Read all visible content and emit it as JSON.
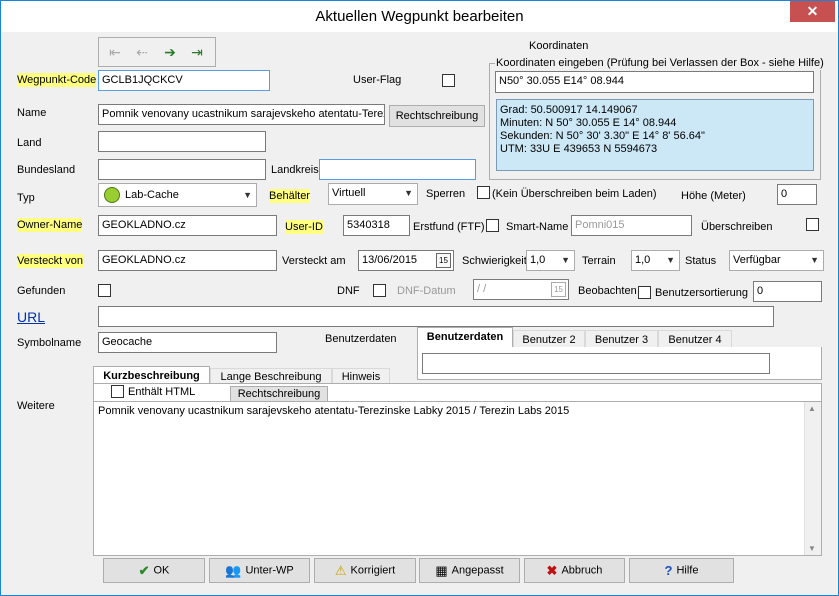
{
  "window": {
    "title": "Aktuellen Wegpunkt bearbeiten",
    "close": "✕"
  },
  "labels": {
    "koordinaten": "Koordinaten",
    "wegpunkt_code": "Wegpunkt-Code",
    "user_flag": "User-Flag",
    "name": "Name",
    "land": "Land",
    "bundesland": "Bundesland",
    "landkreis": "Landkreis",
    "typ": "Typ",
    "behaelter": "Behälter",
    "sperren": "Sperren",
    "kein_ueberschreiben": "(Kein Überschreiben beim Laden)",
    "hoehe": "Höhe (Meter)",
    "owner_name": "Owner-Name",
    "user_id": "User-ID",
    "erstfund": "Erstfund (FTF)",
    "smart_name": "Smart-Name",
    "ueberschreiben": "Überschreiben",
    "versteckt_von": "Versteckt von",
    "versteckt_am": "Versteckt am",
    "schwierigkeit": "Schwierigkeit",
    "terrain": "Terrain",
    "status": "Status",
    "gefunden": "Gefunden",
    "dnf": "DNF",
    "dnf_datum": "DNF-Datum",
    "beobachten": "Beobachten",
    "benutzersortierung": "Benutzersortierung",
    "url": "URL",
    "symbolname": "Symbolname",
    "benutzerdaten": "Benutzerdaten",
    "weitere": "Weitere",
    "enthaelt_html": "Enthält HTML"
  },
  "coords": {
    "group_title": "Koordinaten eingeben (Prüfung bei Verlassen der Box - siehe Hilfe)",
    "input": "N50° 30.055  E14° 08.944",
    "grad": "Grad:  50.500917  14.149067",
    "minuten": "Minuten:  N 50° 30.055  E 14° 08.944",
    "sekunden": "Sekunden:  N 50° 30' 3.30\"  E 14° 8' 56.64\"",
    "utm": "UTM:  33U  E 439653  N 5594673"
  },
  "fields": {
    "wegpunkt_code": "GCLB1JQCKCV",
    "name": "Pomnik venovany ucastnikum sarajevskeho atentatu-Terezi",
    "land": "",
    "bundesland": "",
    "landkreis": "",
    "typ": "Lab-Cache",
    "behaelter": "Virtuell",
    "hoehe": "0",
    "owner_name": "GEOKLADNO.cz",
    "user_id": "5340318",
    "smart_name": "Pomni015",
    "versteckt_von": "GEOKLADNO.cz",
    "versteckt_am": "13/06/2015",
    "schwierigkeit": "1,0",
    "terrain": "1,0",
    "status": "Verfügbar",
    "dnf_datum": " / /",
    "benutzersortierung": "0",
    "url": "",
    "symbolname": "Geocache",
    "benutzerdaten": ""
  },
  "buttons": {
    "rechtschreibung": "Rechtschreibung",
    "rechtschreibung2": "Rechtschreibung",
    "ok": "OK",
    "unter_wp": "Unter-WP",
    "korrigiert": "Korrigiert",
    "angepasst": "Angepasst",
    "abbruch": "Abbruch",
    "hilfe": "Hilfe"
  },
  "user_tabs": [
    "Benutzerdaten",
    "Benutzer 2",
    "Benutzer 3",
    "Benutzer 4"
  ],
  "desc_tabs": [
    "Kurzbeschreibung",
    "Lange Beschreibung",
    "Hinweis"
  ],
  "description": "Pomnik venovany ucastnikum sarajevskeho atentatu-Terezinske Labky 2015 / Terezin Labs 2015",
  "colors": {
    "highlight": "#ffff80",
    "accent": "#1883d7",
    "coord_info_bg": "#cce8f6",
    "url": "#0033aa"
  }
}
